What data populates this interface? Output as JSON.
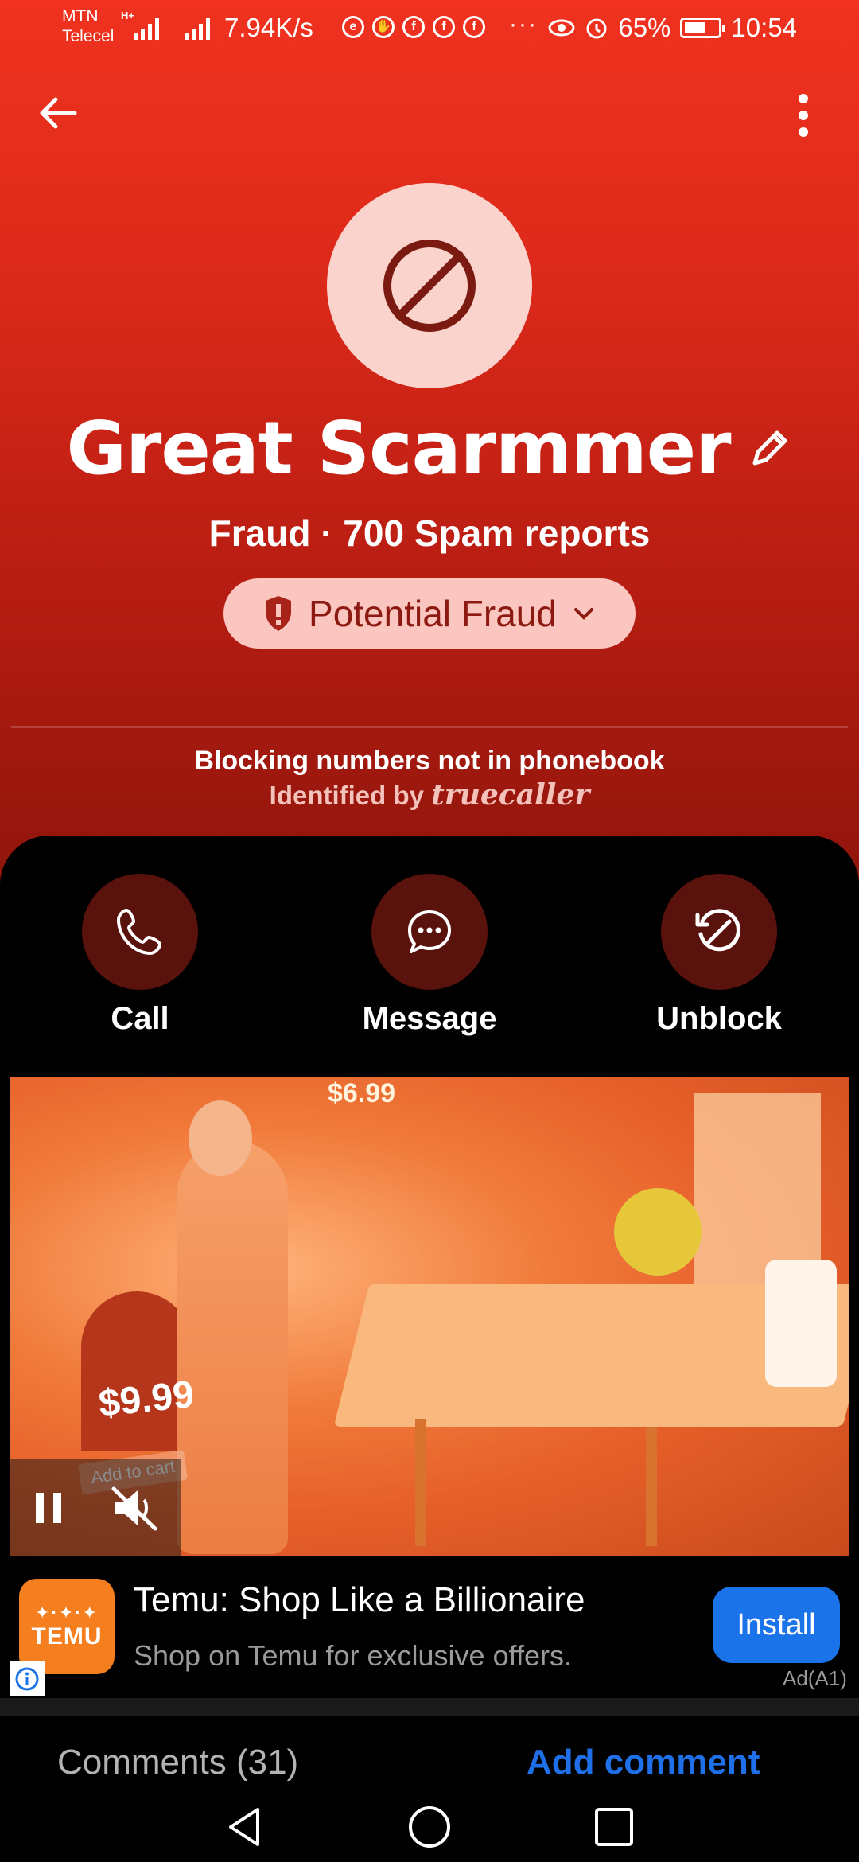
{
  "status_bar": {
    "carrier_1": "MTN",
    "carrier_2": "Telecel",
    "network_type": "H+",
    "speed": "7.94K/s",
    "battery": "65%",
    "battery_level": 0.65,
    "time": "10:54",
    "overflow": "···"
  },
  "contact": {
    "name": "Great Scarmmer",
    "subtitle": "Fraud · 700 Spam reports",
    "badge": "Potential Fraud",
    "blocking_note": "Blocking numbers not in phonebook",
    "identified_prefix": "Identified by",
    "identified_brand": "truecaller",
    "accent_color": "#e8301e"
  },
  "actions": [
    {
      "label": "Call",
      "icon": "phone-icon"
    },
    {
      "label": "Message",
      "icon": "chat-bubble-icon"
    },
    {
      "label": "Unblock",
      "icon": "unblock-icon"
    }
  ],
  "ad": {
    "video_price_1": "$6.99",
    "video_price_2": "$9.99",
    "video_overlay_text": "Add to cart",
    "logo_text": "TEMU",
    "title": "Temu: Shop Like a Billionaire",
    "description": "Shop on Temu for exclusive offers.",
    "install_label": "Install",
    "ad_tag": "Ad(A1)",
    "install_color": "#1a73e8"
  },
  "comments": {
    "label": "Comments (31)",
    "add_label": "Add comment"
  }
}
